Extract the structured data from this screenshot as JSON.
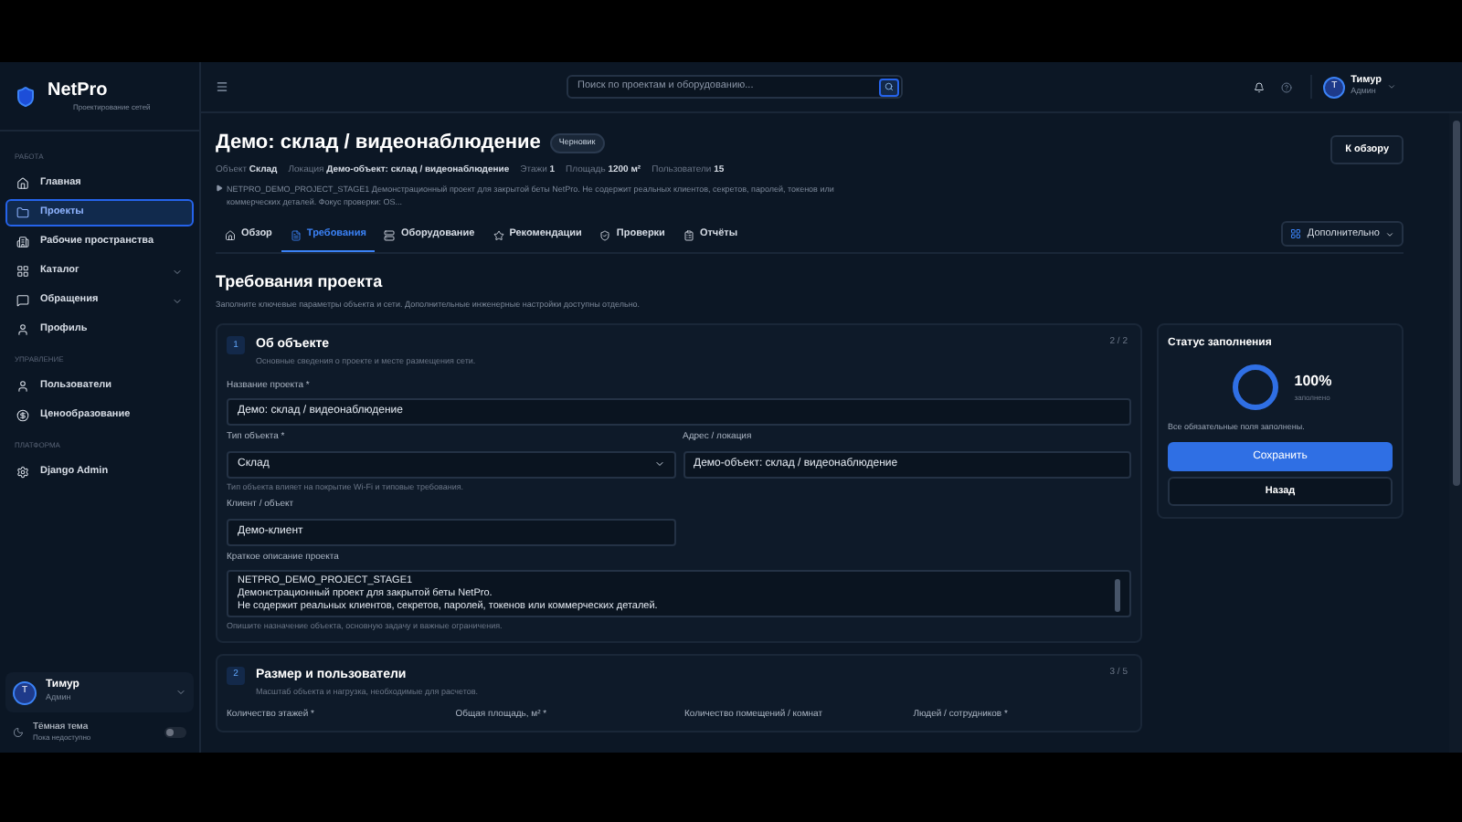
{
  "brand": {
    "name": "NetPro",
    "tagline": "Проектирование сетей"
  },
  "sidebar": {
    "groups": [
      {
        "title": "РАБОТА",
        "items": [
          {
            "label": "Главная",
            "selected": false,
            "expandable": false
          },
          {
            "label": "Проекты",
            "selected": true,
            "expandable": false
          },
          {
            "label": "Рабочие пространства",
            "selected": false,
            "expandable": false
          },
          {
            "label": "Каталог",
            "selected": false,
            "expandable": true
          },
          {
            "label": "Обращения",
            "selected": false,
            "expandable": true
          },
          {
            "label": "Профиль",
            "selected": false,
            "expandable": false
          }
        ]
      },
      {
        "title": "УПРАВЛЕНИЕ",
        "items": [
          {
            "label": "Пользователи",
            "selected": false,
            "expandable": false
          },
          {
            "label": "Ценообразование",
            "selected": false,
            "expandable": false
          }
        ]
      },
      {
        "title": "ПЛАТФОРМА",
        "items": [
          {
            "label": "Django Admin",
            "selected": false,
            "expandable": false
          }
        ]
      }
    ],
    "user": {
      "initial": "Т",
      "name": "Тимур",
      "role": "Админ"
    },
    "theme": {
      "label": "Тёмная тема",
      "hint": "Пока недоступно",
      "on": false
    }
  },
  "topbar": {
    "search": {
      "placeholder": "Поиск по проектам и оборудованию..."
    },
    "user": {
      "initial": "Т",
      "name": "Тимур",
      "role": "Админ"
    }
  },
  "project": {
    "title": "Демо: склад / видеонаблюдение",
    "badge": "Черновик",
    "back_button": "К обзору",
    "meta": [
      "Объект **Склад**",
      "Локация **Демо-объект: склад / видеонаблюдение**",
      "Этажи **1**",
      "Площадь **1200 м²**",
      "Пользователи **15**"
    ],
    "description": "NETPRO_DEMO_PROJECT_STAGE1 Демонстрационный проект для закрытой беты NetPro. Не содержит реальных клиентов, секретов, паролей, токенов или коммерческих деталей. Фокус проверки: OS..."
  },
  "tabs": [
    {
      "label": "Обзор",
      "selected": false
    },
    {
      "label": "Требования",
      "selected": true
    },
    {
      "label": "Оборудование",
      "selected": false
    },
    {
      "label": "Рекомендации",
      "selected": false
    },
    {
      "label": "Проверки",
      "selected": false
    },
    {
      "label": "Отчёты",
      "selected": false
    }
  ],
  "more_button": "Дополнительно",
  "page": {
    "title": "Требования проекта",
    "subtitle": "Заполните ключевые параметры объекта и сети. Дополнительные инженерные настройки доступны отдельно."
  },
  "sections": [
    {
      "number": "1",
      "title": "Об объекте",
      "subtitle": "Основные сведения о проекте и месте размещения сети.",
      "counter": "2 / 2",
      "fields": [
        {
          "kind": "input",
          "label": "Название проекта *",
          "value": "Демо: склад / видеонаблюдение"
        },
        {
          "kind": "select",
          "label": "Тип объекта *",
          "value": "Склад",
          "hint": "Тип объекта влияет на покрытие Wi-Fi и типовые требования."
        },
        {
          "kind": "input",
          "label": "Адрес / локация",
          "value": "Демо-объект: склад / видеонаблюдение"
        },
        {
          "kind": "input",
          "label": "Клиент / объект",
          "value": "Демо-клиент"
        },
        {
          "kind": "textarea",
          "label": "Краткое описание проекта",
          "lines": [
            "NETPRO_DEMO_PROJECT_STAGE1",
            "Демонстрационный проект для закрытой беты NetPro.",
            "Не содержит реальных клиентов, секретов, паролей, токенов или коммерческих деталей."
          ],
          "hint": "Опишите назначение объекта, основную задачу и важные ограничения."
        }
      ]
    },
    {
      "number": "2",
      "title": "Размер и пользователи",
      "subtitle": "Масштаб объекта и нагрузка, необходимые для расчетов.",
      "counter": "3 / 5",
      "fields": [
        {
          "kind": "label",
          "label": "Количество этажей *"
        },
        {
          "kind": "label",
          "label": "Общая площадь, м² *"
        },
        {
          "kind": "label",
          "label": "Количество помещений / комнат"
        },
        {
          "kind": "label",
          "label": "Людей / сотрудников *"
        }
      ]
    }
  ],
  "status": {
    "title": "Статус заполнения",
    "percent": "100%",
    "caption": "заполнено",
    "level": 1,
    "message": "Все обязательные поля заполнены.",
    "save_button": "Сохранить",
    "back_button": "Назад"
  }
}
